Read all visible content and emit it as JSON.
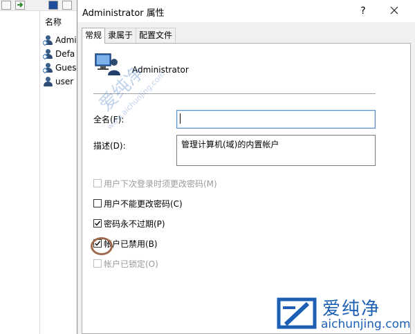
{
  "background": {
    "list_header": "名称",
    "users": [
      {
        "name": "Admi"
      },
      {
        "name": "Defa"
      },
      {
        "name": "Gues"
      },
      {
        "name": "user"
      }
    ]
  },
  "dialog": {
    "title": "Administrator 属性",
    "help_label": "?",
    "tabs": [
      {
        "label": "常规",
        "active": true
      },
      {
        "label": "隶属于",
        "active": false
      },
      {
        "label": "配置文件",
        "active": false
      }
    ],
    "account_name": "Administrator",
    "fullname_label": "全名(F):",
    "fullname_value": "",
    "description_label": "描述(D):",
    "description_value": "管理计算机(域)的内置帐户",
    "checkboxes": [
      {
        "label": "用户下次登录时须更改密码(M)",
        "checked": false,
        "enabled": false
      },
      {
        "label": "用户不能更改密码(C)",
        "checked": false,
        "enabled": true
      },
      {
        "label": "密码永不过期(P)",
        "checked": true,
        "enabled": true
      },
      {
        "label": "帐户已禁用(B)",
        "checked": true,
        "enabled": true
      },
      {
        "label": "帐户已锁定(O)",
        "checked": false,
        "enabled": false
      }
    ]
  },
  "watermark": {
    "brand": "爱纯净",
    "url": "aichunjing.com",
    "diagonal_text": "爱纯净",
    "diagonal_url": "www.aichunjing.com",
    "color": "#1c5fb5"
  },
  "icons": [
    "user-icon",
    "help-icon",
    "close-icon",
    "checkmark-icon",
    "admin-computer-icon"
  ]
}
